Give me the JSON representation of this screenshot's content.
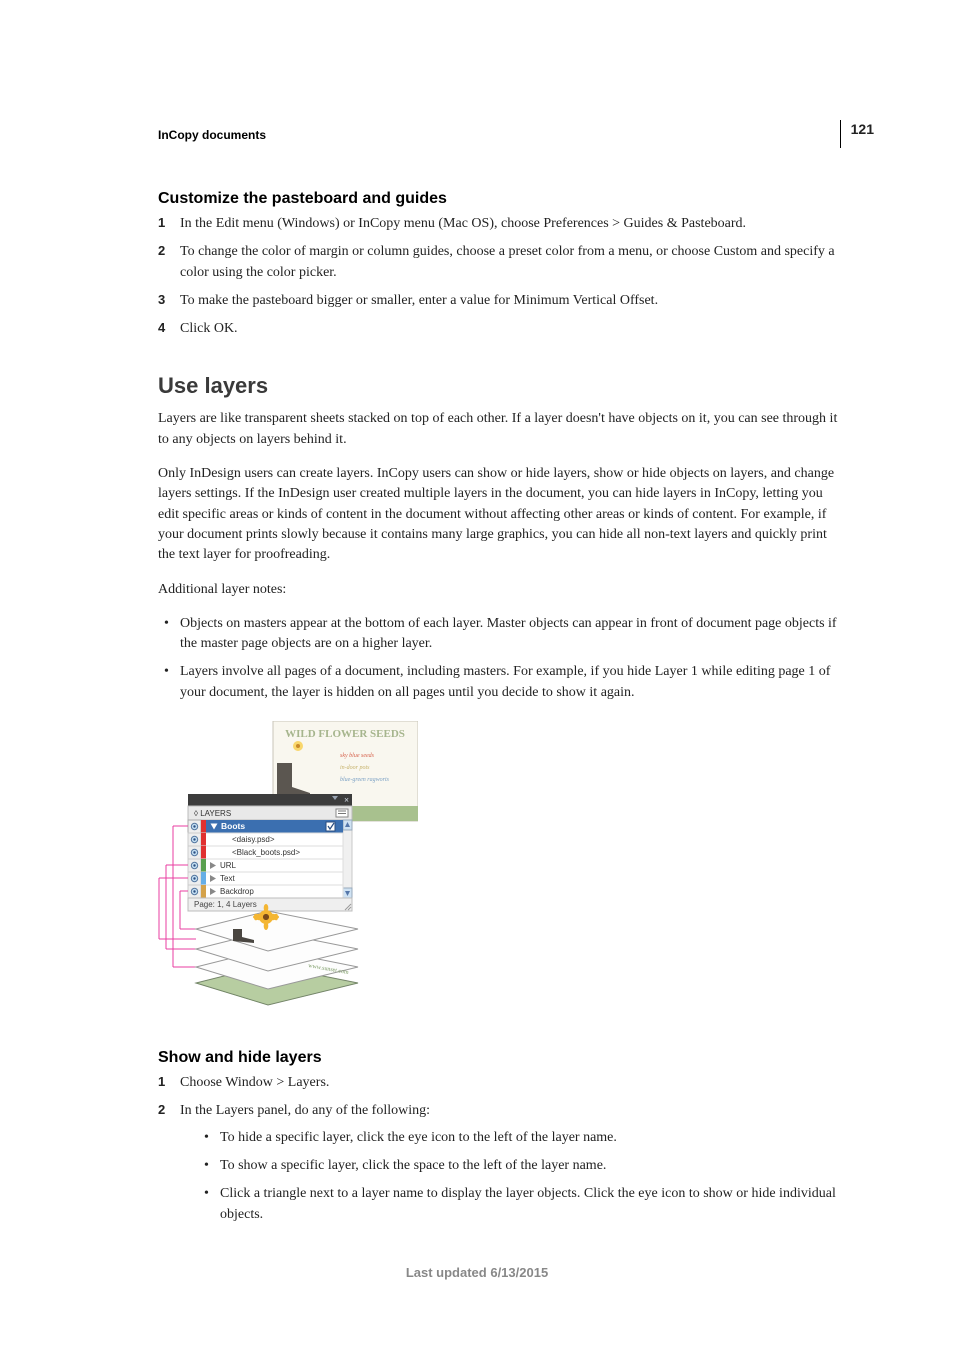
{
  "page_number": "121",
  "doc_header": "InCopy documents",
  "section1": {
    "heading": "Customize the pasteboard and guides",
    "steps": {
      "s1": "In the Edit menu (Windows) or InCopy menu (Mac OS), choose Preferences > Guides & Pasteboard.",
      "s2": "To change the color of margin or column guides, choose a preset color from a menu, or choose Custom and specify a color using the color picker.",
      "s3": "To make the pasteboard bigger or smaller, enter a value for Minimum Vertical Offset.",
      "s4": "Click OK."
    }
  },
  "use_layers": {
    "heading": "Use layers",
    "para1": "Layers are like transparent sheets stacked on top of each other. If a layer doesn't have objects on it, you can see through it to any objects on layers behind it.",
    "para2": "Only InDesign users can create layers. InCopy users can show or hide layers, show or hide objects on layers, and change layers settings. If the InDesign user created multiple layers in the document, you can hide layers in InCopy, letting you edit specific areas or kinds of content in the document without affecting other areas or kinds of content. For example, if your document prints slowly because it contains many large graphics, you can hide all non-text layers and quickly print the text layer for proofreading.",
    "para3": "Additional layer notes:",
    "bullets": {
      "b1": "Objects on masters appear at the bottom of each layer. Master objects can appear in front of document page objects if the master page objects are on a higher layer.",
      "b2": "Layers involve all pages of a document, including masters. For example, if you hide Layer 1 while editing page 1 of your document, the layer is hidden on all pages until you decide to show it again."
    }
  },
  "figure": {
    "panel_title": "LAYERS",
    "doc_title": "WILD FLOWER SEEDS",
    "rows": {
      "r1": "Boots",
      "r2": "<daisy.psd>",
      "r3": "<Black_boots.psd>",
      "r4": "URL",
      "r5": "Text",
      "r6": "Backdrop"
    },
    "status": "Page: 1, 4 Layers",
    "tiny": {
      "t1": "sky blue seeds",
      "t2": "in-door pots",
      "t3": "blue-green ragworts",
      "t4": "sunset.com"
    }
  },
  "section3": {
    "heading": "Show and hide layers",
    "steps": {
      "s1": "Choose Window > Layers.",
      "s2": "In the Layers panel, do any of the following:"
    },
    "sub": {
      "a": "To hide a specific layer, click the eye icon to the left of the layer name.",
      "b": "To show a specific layer, click the space to the left of the layer name.",
      "c": "Click a triangle next to a layer name to display the layer objects. Click the eye icon to show or hide individual objects."
    }
  },
  "footer": "Last updated 6/13/2015"
}
